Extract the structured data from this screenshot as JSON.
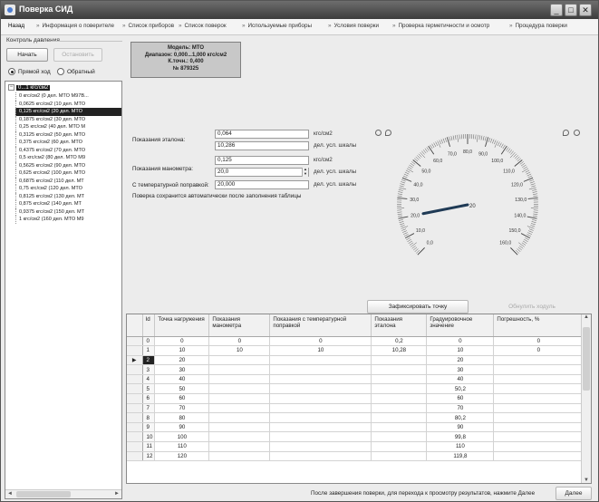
{
  "window": {
    "title": "Поверка СИД",
    "controls": [
      "_",
      "□",
      "✕"
    ]
  },
  "steps": [
    {
      "label": "Назад",
      "active": true
    },
    {
      "label": "Информация о поверителе"
    },
    {
      "label": "Список приборов"
    },
    {
      "label": "Список поверок"
    },
    {
      "label": "Используемые приборы"
    },
    {
      "label": "Условия поверки"
    },
    {
      "label": "Проверка герметичности и осмотр"
    },
    {
      "label": "Процедура поверки"
    }
  ],
  "pressure_control": {
    "group_label": "Контроль давления",
    "start_label": "Начать",
    "stop_label": "Остановить",
    "forward_label": "Прямой ход",
    "reverse_label": "Обратный",
    "direction": "forward"
  },
  "tree": {
    "root_label": "0...1 кгс/см2",
    "items": [
      "0 кгс/см2 (0 дел. МТО М97В...",
      "0,0625 кгс/см2 (10 дел. МТО",
      "0,125 кгс/см2 (20 дел. МТО",
      "0,1875 кгс/см2 (30 дел. МТО",
      "0,25 кгс/см2 (40 дел. МТО М",
      "0,3125 кгс/см2 (50 дел. МТО",
      "0,375 кгс/см2 (60 дел. МТО",
      "0,4375 кгс/см2 (70 дел. МТО",
      "0,5 кгс/см2 (80 дел. МТО М9",
      "0,5625 кгс/см2 (90 дел. МТО",
      "0,625 кгс/см2 (100 дел. МТО",
      "0,6875 кгс/см2 (110 дел. МТ",
      "0,75 кгс/см2 (120 дел. МТО",
      "0,8125 кгс/см2 (130 дел. МТ",
      "0,875 кгс/см2 (140 дел. МТ",
      "0,9375 кгс/см2 (150 дел. МТ",
      "1 кгс/см2 (160 дел. МТО М9"
    ],
    "selected_index": 2
  },
  "model_info": {
    "model": "Модель: МТО",
    "range": "Диапазон: 0,000...1,000 кгс/см2",
    "accuracy": "К.точн.: 0,400",
    "serial": "№ 879325"
  },
  "readings": {
    "reference_label": "Показания эталона:",
    "reference_value": "0,064",
    "reference_unit": "кгс/см2",
    "reference_div_value": "10,286",
    "reference_div_unit": "дел. усл. шкалы",
    "gauge_label": "Показания манометра:",
    "gauge_value": "0,125",
    "gauge_unit": "кгс/см2",
    "gauge_div_value": "20,0",
    "gauge_div_unit": "дел. усл. шкалы",
    "temp_label": "С температурной поправкой:",
    "temp_value": "20,000",
    "temp_unit": "дел. усл. шкалы",
    "auto_save_note": "Поверка сохранится автоматически после заполнения таблицы"
  },
  "gauge": {
    "min": 0,
    "max": 160,
    "needle_value": 20,
    "center_label": "20",
    "major_labels": [
      "0,0",
      "10,0",
      "20,0",
      "30,0",
      "40,0",
      "50,0",
      "60,0",
      "70,0",
      "80,0",
      "90,0",
      "100,0",
      "110,0",
      "120,0",
      "130,0",
      "140,0",
      "150,0",
      "160,0"
    ]
  },
  "actions": {
    "fix_point_label": "Зафиксировать точку",
    "reset_label": "Обнулить ходуль"
  },
  "grid": {
    "columns": [
      "Id",
      "Точка нагружения",
      "Показания манометра",
      "Показания с температурной поправкой",
      "Показания эталона",
      "Градуировочное значение",
      "Погрешность, %"
    ],
    "current_row": 2,
    "rows": [
      [
        "0",
        "0",
        "0",
        "0",
        "0,2",
        "0",
        "0"
      ],
      [
        "1",
        "10",
        "10",
        "10",
        "10,28",
        "10",
        "0"
      ],
      [
        "2",
        "20",
        "",
        "",
        "",
        "20",
        ""
      ],
      [
        "3",
        "30",
        "",
        "",
        "",
        "30",
        ""
      ],
      [
        "4",
        "40",
        "",
        "",
        "",
        "40",
        ""
      ],
      [
        "5",
        "50",
        "",
        "",
        "",
        "50,2",
        ""
      ],
      [
        "6",
        "60",
        "",
        "",
        "",
        "60",
        ""
      ],
      [
        "7",
        "70",
        "",
        "",
        "",
        "70",
        ""
      ],
      [
        "8",
        "80",
        "",
        "",
        "",
        "80,2",
        ""
      ],
      [
        "9",
        "90",
        "",
        "",
        "",
        "90",
        ""
      ],
      [
        "10",
        "100",
        "",
        "",
        "",
        "99,8",
        ""
      ],
      [
        "11",
        "110",
        "",
        "",
        "",
        "110",
        ""
      ],
      [
        "12",
        "120",
        "",
        "",
        "",
        "119,8",
        ""
      ]
    ]
  },
  "footer": {
    "hint": "После завершения поверки, для перехода к просмотру результатов, нажмите Далее",
    "next_label": "Далее"
  },
  "colors": {
    "title_bar": "#4a4a4a",
    "selected_row": "#222222",
    "needle": "#1f3a55"
  }
}
